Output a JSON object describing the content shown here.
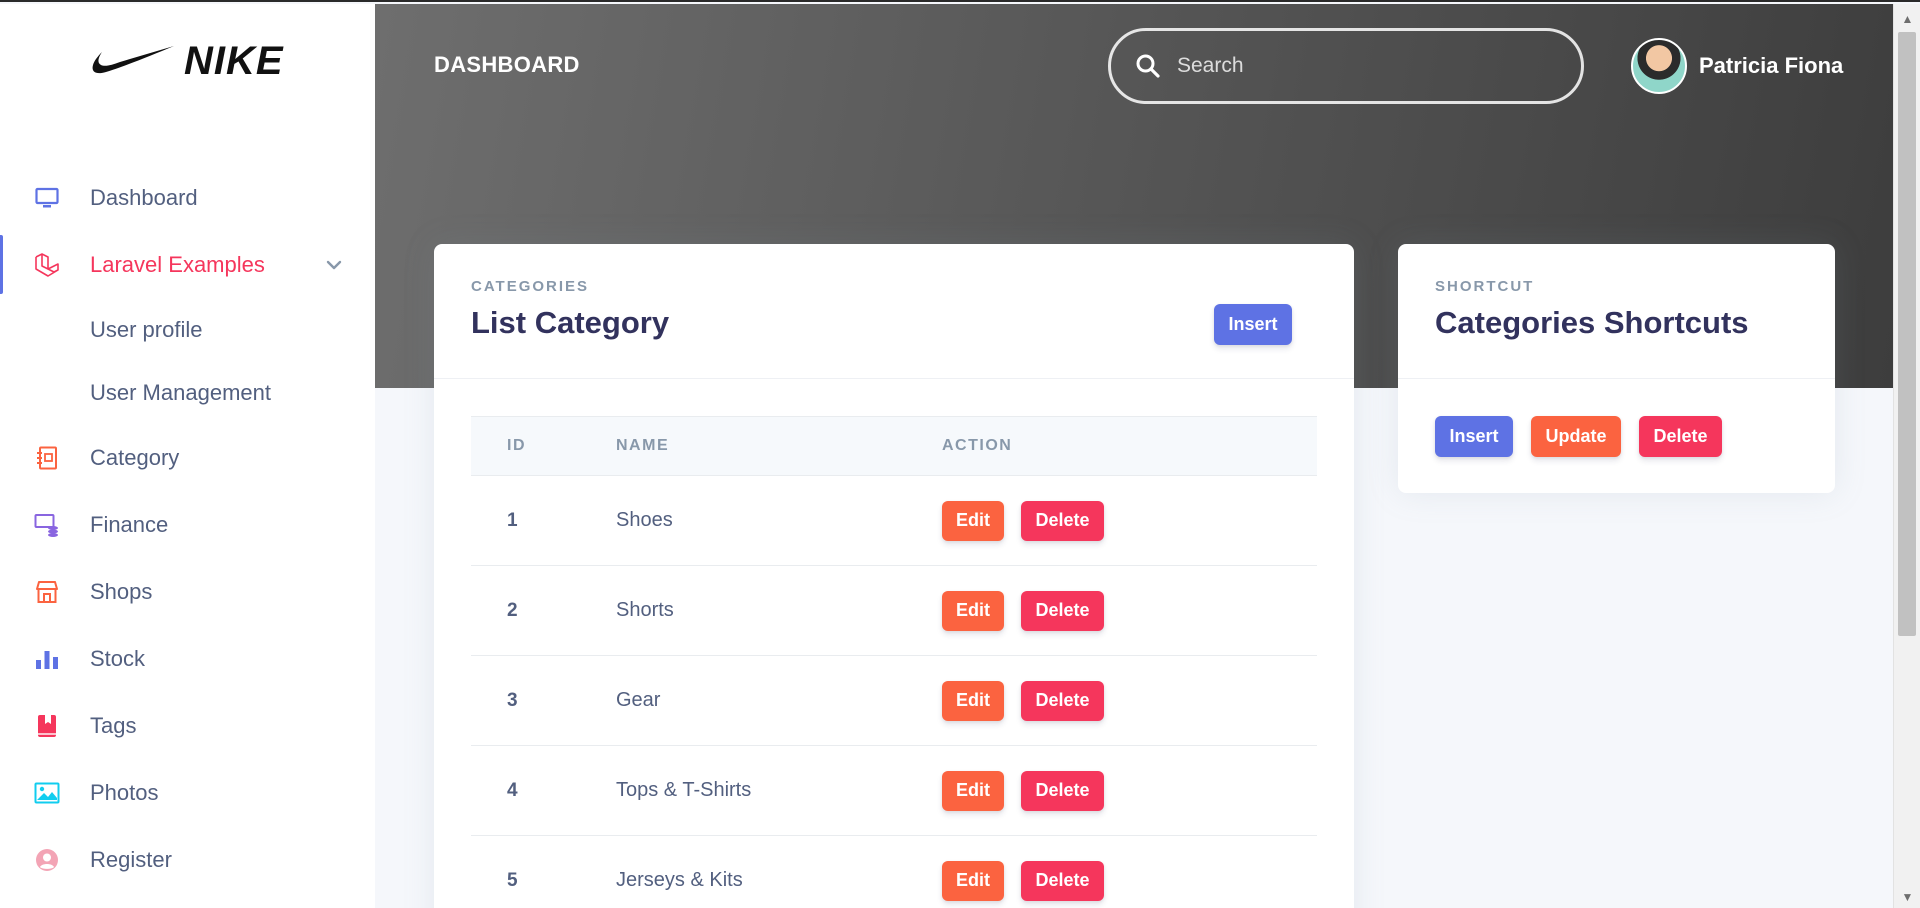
{
  "brand": {
    "name": "NIKE",
    "logo_icon": "nike-swoosh-icon"
  },
  "sidebar": {
    "items": [
      {
        "label": "Dashboard",
        "icon": "monitor-icon",
        "color": "#5e72e4"
      },
      {
        "label": "Laravel Examples",
        "icon": "laravel-icon",
        "color": "#f5365c",
        "active": true,
        "expanded": true,
        "children": [
          {
            "label": "User profile"
          },
          {
            "label": "User Management"
          }
        ]
      },
      {
        "label": "Category",
        "icon": "notebook-icon",
        "color": "#fb6340"
      },
      {
        "label": "Finance",
        "icon": "money-stack-icon",
        "color": "#8965e0"
      },
      {
        "label": "Shops",
        "icon": "shop-icon",
        "color": "#fb6340"
      },
      {
        "label": "Stock",
        "icon": "bar-chart-icon",
        "color": "#5e72e4"
      },
      {
        "label": "Tags",
        "icon": "bookmark-icon",
        "color": "#f5365c"
      },
      {
        "label": "Photos",
        "icon": "image-icon",
        "color": "#11cdef"
      },
      {
        "label": "Register",
        "icon": "user-circle-icon",
        "color": "#f3a4b5"
      }
    ]
  },
  "header": {
    "title": "DASHBOARD",
    "search": {
      "placeholder": "Search",
      "value": ""
    },
    "user": {
      "name": "Patricia Fiona"
    }
  },
  "categories_card": {
    "eyebrow": "CATEGORIES",
    "title": "List Category",
    "insert_label": "Insert",
    "columns": [
      "ID",
      "NAME",
      "ACTION"
    ],
    "edit_label": "Edit",
    "delete_label": "Delete",
    "rows": [
      {
        "id": "1",
        "name": "Shoes"
      },
      {
        "id": "2",
        "name": "Shorts"
      },
      {
        "id": "3",
        "name": "Gear"
      },
      {
        "id": "4",
        "name": "Tops & T-Shirts"
      },
      {
        "id": "5",
        "name": "Jerseys & Kits"
      }
    ]
  },
  "shortcut_card": {
    "eyebrow": "SHORTCUT",
    "title": "Categories Shortcuts",
    "buttons": {
      "insert": "Insert",
      "update": "Update",
      "delete": "Delete"
    }
  },
  "colors": {
    "primary": "#5e72e4",
    "warning": "#fb6340",
    "danger": "#f5365c",
    "heading": "#32325d",
    "muted": "#8898aa"
  }
}
